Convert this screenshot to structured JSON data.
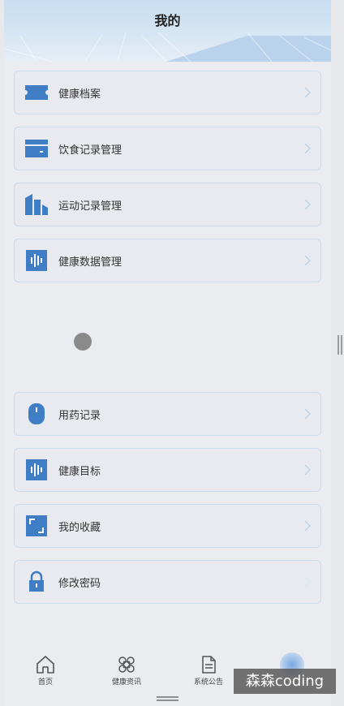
{
  "header": {
    "title": "我的"
  },
  "menu_top": [
    {
      "label": "健康档案",
      "icon": "ticket-icon"
    },
    {
      "label": "饮食记录管理",
      "icon": "wallet-icon"
    },
    {
      "label": "运动记录管理",
      "icon": "buildings-icon"
    },
    {
      "label": "健康数据管理",
      "icon": "waveform-icon"
    }
  ],
  "menu_bottom": [
    {
      "label": "用药记录",
      "icon": "capsule-icon"
    },
    {
      "label": "健康目标",
      "icon": "waveform-icon"
    },
    {
      "label": "我的收藏",
      "icon": "frame-corners-icon"
    },
    {
      "label": "修改密码",
      "icon": "lock-icon"
    }
  ],
  "tabbar": {
    "items": [
      {
        "label": "首页",
        "icon": "home-icon"
      },
      {
        "label": "健康资讯",
        "icon": "command-icon"
      },
      {
        "label": "系统公告",
        "icon": "document-icon"
      },
      {
        "label": "",
        "icon": "profile-icon"
      }
    ]
  },
  "watermark": "森森coding",
  "colors": {
    "icon": "#3f7ec4",
    "border": "#c9dcec",
    "header": "#c7ddf0"
  }
}
